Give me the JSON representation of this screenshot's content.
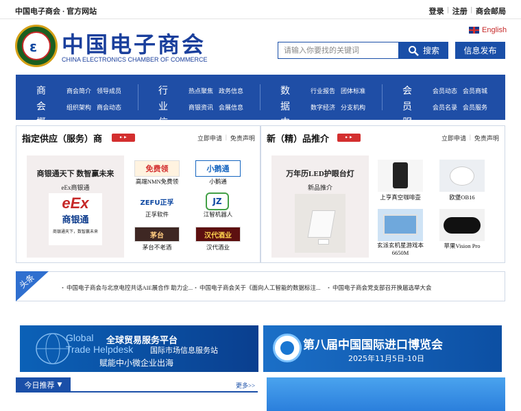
{
  "top": {
    "site_label": "中国电子商会 · 官方网站",
    "links": [
      "登录",
      "注册",
      "商会邮局"
    ],
    "sep": "|"
  },
  "header": {
    "brand_cn": "中国电子商会",
    "brand_en": "CHINA ELECTRONICS CHAMBER OF COMMERCE",
    "lang_label": "English",
    "search_placeholder": "请输入你要找的关键词",
    "search_button": "搜索",
    "publish_button": "信息发布"
  },
  "nav": [
    {
      "title": [
        "商会",
        "概况"
      ],
      "links": [
        "商会简介",
        "领导成员",
        "组织架构",
        "商会动态"
      ]
    },
    {
      "title": [
        "行业",
        "信息"
      ],
      "links": [
        "热点聚焦",
        "政务信息",
        "商银资讯",
        "会展信息"
      ]
    },
    {
      "title": [
        "数据",
        "中心"
      ],
      "links": [
        "行业报告",
        "团体标准",
        "数字经济",
        "分支机构"
      ]
    },
    {
      "title": [
        "会员",
        "服务"
      ],
      "links": [
        "会员动态",
        "会员商城",
        "会员名录",
        "会员服务"
      ]
    }
  ],
  "suppliers": {
    "title": "指定供应（服务）商",
    "links": [
      "立即申请",
      "免责声明"
    ],
    "feature": {
      "headline": "商银通天下 数智赢未来",
      "sub": "eEx商银通",
      "logo_text": "eEx",
      "logo_cn": "商银通",
      "logo_caption": "商银通天下，数智赢未来"
    },
    "items": [
      {
        "caption": "高端NMN免费领",
        "thumb": "免费领"
      },
      {
        "caption": "小鹅通",
        "thumb": "小鹅通"
      },
      {
        "caption": "正孚软件",
        "thumb": "ZEFU正孚"
      },
      {
        "caption": "江智机器人",
        "thumb": "JZ"
      },
      {
        "caption": "茅台不老酒",
        "thumb": "茅台"
      },
      {
        "caption": "汉代酒业",
        "thumb": "汉代酒业"
      }
    ]
  },
  "products": {
    "title": "新（精）品推介",
    "links": [
      "立即申请",
      "免责声明"
    ],
    "feature": {
      "headline": "万年历LED护眼台灯",
      "sub": "新品推介"
    },
    "items": [
      {
        "caption": "上亨真空咖啡壶"
      },
      {
        "caption": "欧堡OB16"
      },
      {
        "caption": "玄派玄机星游戏本\n6650M"
      },
      {
        "caption": "苹果Vision Pro"
      }
    ]
  },
  "headlines": {
    "label": "头条",
    "items": [
      "中国电子商会与北京电控共话AIE展合作 助力企...",
      "中国电子商会关于《面向人工智能的数据标注...",
      "中国电子商会党支部召开换届选举大会"
    ]
  },
  "banners": {
    "left": {
      "en1": "Global",
      "en2": "Trade Helpdesk",
      "cn1": "全球贸易服务平台",
      "cn2": "国际市场信息服务站",
      "cn3": "赋能中小微企业出海"
    },
    "right": {
      "title": "第八届中国国际进口博览会",
      "date": "2025年11月5日-10日"
    }
  },
  "today": {
    "tab": "今日推荐",
    "more": "更多>>"
  }
}
